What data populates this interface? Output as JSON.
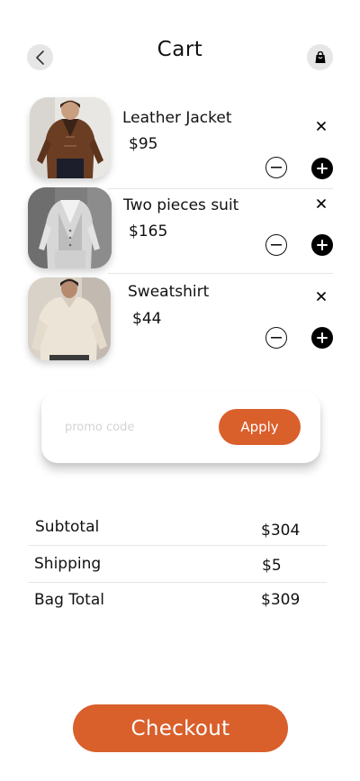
{
  "header": {
    "title": "Cart",
    "back_icon": "chevron-left-icon",
    "bag_icon": "shopping-bag-icon"
  },
  "cart": {
    "items": [
      {
        "name": "Leather Jacket",
        "price": "$95",
        "image": "leather-jacket-photo"
      },
      {
        "name": "Two pieces suit",
        "price": "$165",
        "image": "two-pieces-suit-photo"
      },
      {
        "name": "Sweatshirt",
        "price": "$44",
        "image": "sweatshirt-photo"
      }
    ],
    "remove_icon": "close-icon",
    "decrement_icon": "minus-circle-icon",
    "increment_icon": "plus-circle-icon"
  },
  "promo": {
    "placeholder": "promo code",
    "apply_label": "Apply"
  },
  "totals": {
    "subtotal_label": "Subtotal",
    "subtotal_value": "$304",
    "shipping_label": "Shipping",
    "shipping_value": "$5",
    "bag_total_label": "Bag Total",
    "bag_total_value": "$309"
  },
  "checkout": {
    "label": "Checkout"
  },
  "colors": {
    "accent": "#d95f2b",
    "icon_bg": "#e6e6e6",
    "text": "#111111",
    "placeholder": "#d4d4d4"
  }
}
